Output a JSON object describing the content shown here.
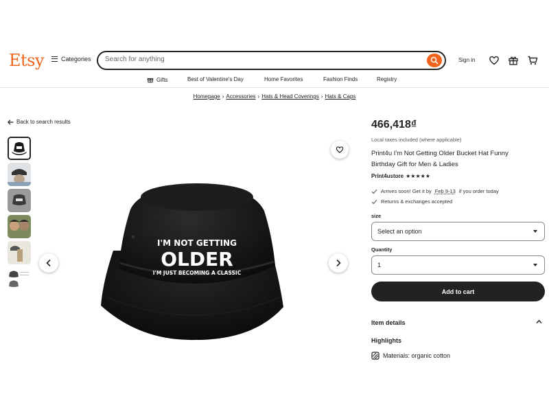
{
  "header": {
    "logo": "Etsy",
    "categories_label": "Categories",
    "search_placeholder": "Search for anything",
    "signin_label": "Sign in",
    "icons": [
      "heart-icon",
      "gift-icon",
      "cart-icon"
    ]
  },
  "subnav": {
    "items": [
      "Gifts",
      "Best of Valentine's Day",
      "Home Favorites",
      "Fashion Finds",
      "Registry"
    ]
  },
  "breadcrumb": [
    "Homepage",
    "Accessories",
    "Hats & Head Coverings",
    "Hats & Caps"
  ],
  "back_label": "Back to search results",
  "product_image": {
    "print_line1": "I'M NOT GETTING",
    "print_line2": "OLDER",
    "print_line3": "I'M JUST BECOMING A CLASSIC"
  },
  "product": {
    "price": "466,418₫",
    "tax_note": "Local taxes included (where applicable)",
    "title": "Print4u I'm Not Getting Older Bucket Hat Funny Birthday Gift for Men & Ladies",
    "shop": "Print4ustore",
    "rating_stars": "★★★★★",
    "arrival_prefix": "Arrives soon! Get it by",
    "arrival_date": "Feb 9-13",
    "arrival_suffix": "if you order today",
    "returns": "Returns & exchanges accepted",
    "size_label": "size",
    "size_value": "Select an option",
    "quantity_label": "Quantity",
    "quantity_value": "1",
    "add_to_cart": "Add to cart",
    "item_details": "Item details",
    "highlights": "Highlights",
    "materials": "Materials: organic cotton"
  },
  "colors": {
    "brand": "#f1641e",
    "dark": "#222222",
    "divider": "#e1e3df"
  }
}
